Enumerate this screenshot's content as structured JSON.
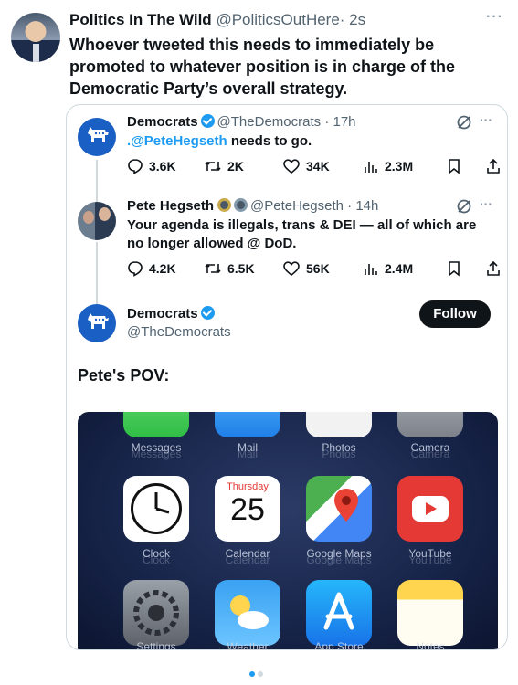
{
  "outer_tweet": {
    "name": "Politics In The Wild",
    "handle": "@PoliticsOutHere",
    "time": "· 2s",
    "text": "Whoever tweeted this needs to immediately be promoted to whatever position is in charge of the Democratic Party’s overall strategy.",
    "more": "···"
  },
  "quoted": {
    "tweet1": {
      "name": "Democrats",
      "handle": "@TheDemocrats",
      "time": "· 17h",
      "mention": ".@PeteHegseth",
      "text": " needs to go.",
      "more": "···",
      "metrics": {
        "replies": "3.6K",
        "reposts": "2K",
        "likes": "34K",
        "views": "2.3M"
      }
    },
    "tweet2": {
      "name": "Pete Hegseth",
      "handle": "@PeteHegseth",
      "time": "· 14h",
      "text": "Your agenda is illegals, trans & DEI — all of which are no longer allowed @ DoD.",
      "more": "···",
      "metrics": {
        "replies": "4.2K",
        "reposts": "6.5K",
        "likes": "56K",
        "views": "2.4M"
      }
    },
    "tweet3": {
      "name": "Democrats",
      "handle": "@TheDemocrats",
      "follow_label": "Follow",
      "text": "Pete's POV:"
    }
  },
  "media": {
    "row1_labels": [
      "Messages",
      "Mail",
      "Photos",
      "Camera"
    ],
    "row2_labels": [
      "Clock",
      "Calendar",
      "Google Maps",
      "YouTube"
    ],
    "row3_labels": [
      "Settings",
      "Weather",
      "App Store",
      "Notes"
    ],
    "calendar_day_name": "Thursday",
    "calendar_day_number": "25"
  },
  "colors": {
    "accent": "#1d9bf0",
    "democrats_blue": "#1a5fc4",
    "text": "#0f1419",
    "secondary_text": "#536471"
  }
}
